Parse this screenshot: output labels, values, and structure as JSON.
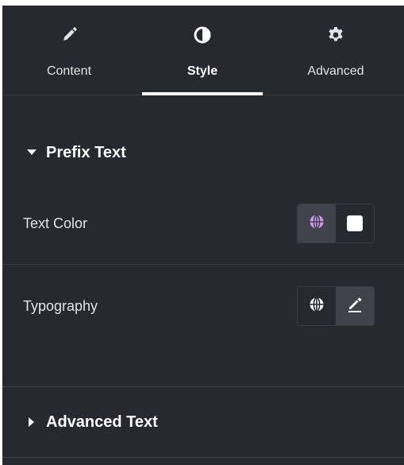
{
  "tabs": [
    {
      "label": "Content",
      "icon": "pencil-icon",
      "active": false
    },
    {
      "label": "Style",
      "icon": "contrast-icon",
      "active": true
    },
    {
      "label": "Advanced",
      "icon": "gear-icon",
      "active": false
    }
  ],
  "sections": {
    "prefix": {
      "title": "Prefix Text",
      "expanded": true,
      "controls": {
        "text_color": {
          "label": "Text Color",
          "global_icon": "globe-icon",
          "swatch_color": "#ffffff"
        },
        "typography": {
          "label": "Typography",
          "global_icon": "globe-icon",
          "edit_icon": "pencil-icon"
        }
      }
    },
    "advanced": {
      "title": "Advanced Text",
      "expanded": false
    }
  },
  "colors": {
    "panel_bg": "#26292f",
    "global_active": "#d595f5",
    "text": "#e2e3e5"
  }
}
